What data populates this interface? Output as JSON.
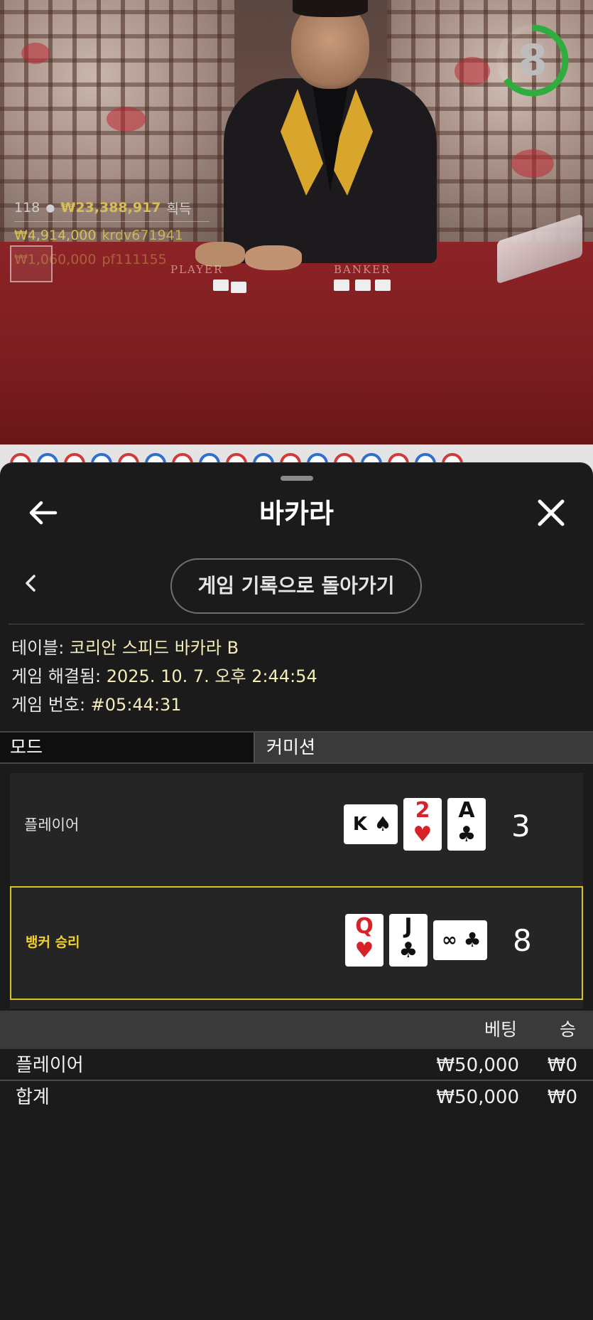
{
  "stream": {
    "countdown": "8",
    "countdown_progress": 0.65,
    "players_count": "118",
    "total_winnings": "₩23,388,917",
    "winnings_label": "획득",
    "winners": [
      {
        "amount": "₩4,914,000",
        "user": "krdv671941"
      },
      {
        "amount": "₩1,060,000",
        "user": "pf111155"
      }
    ],
    "felt_player": "PLAYER",
    "felt_banker": "BANKER"
  },
  "road_colors": [
    "red",
    "blue",
    "red",
    "blue",
    "red",
    "blue",
    "red",
    "blue",
    "red",
    "blue",
    "red",
    "blue",
    "red",
    "blue",
    "red",
    "blue",
    "red"
  ],
  "header": {
    "title": "바카라",
    "back_icon": "arrow-left-icon",
    "close_icon": "close-icon"
  },
  "nav": {
    "history_button": "게임 기록으로 돌아가기"
  },
  "details": {
    "table_label": "테이블: ",
    "table_value": "코리안 스피드 바카라 B",
    "resolved_label": "게임 해결됨: ",
    "resolved_value": "2025. 10. 7. 오후 2:44:54",
    "number_label": "게임 번호: ",
    "number_value": "#05:44:31"
  },
  "tabs": [
    {
      "label": "모드"
    },
    {
      "label": "커미션"
    }
  ],
  "hands": {
    "player": {
      "label": "플레이어",
      "score": "3",
      "cards": [
        {
          "rank": "K",
          "suit": "♠",
          "color": "black",
          "sideways": true
        },
        {
          "rank": "2",
          "suit": "♥",
          "color": "red",
          "sideways": false
        },
        {
          "rank": "A",
          "suit": "♣",
          "color": "black",
          "sideways": false
        }
      ]
    },
    "banker": {
      "label": "뱅커 승리",
      "score": "8",
      "cards": [
        {
          "rank": "Q",
          "suit": "♥",
          "color": "red",
          "sideways": false
        },
        {
          "rank": "J",
          "suit": "♣",
          "color": "black",
          "sideways": false
        },
        {
          "rank": "8",
          "suit": "♣",
          "color": "black",
          "sideways": true
        }
      ]
    }
  },
  "bets": {
    "col_bet": "베팅",
    "col_win": "승",
    "rows": [
      {
        "name": "플레이어",
        "bet": "₩50,000",
        "win": "₩0"
      },
      {
        "name": "합계",
        "bet": "₩50,000",
        "win": "₩0"
      }
    ]
  },
  "colors": {
    "accent_gold": "#f2d229",
    "timer_green": "#2fae3f",
    "sheet_bg": "#1b1b1b"
  }
}
